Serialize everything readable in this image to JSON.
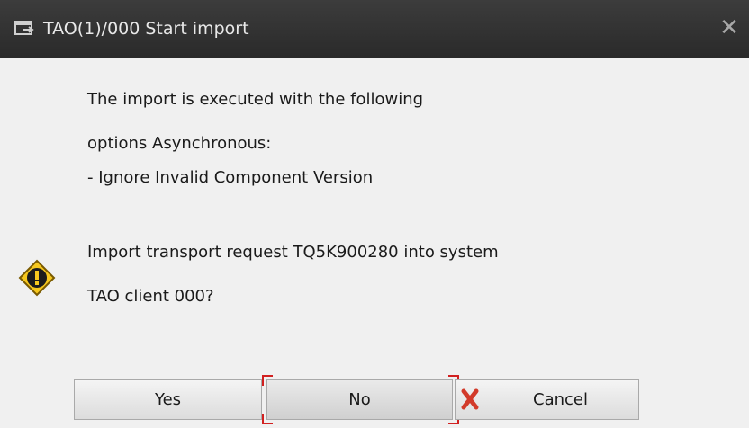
{
  "dialog": {
    "title": "TAO(1)/000 Start import",
    "close_glyph": "✕",
    "title_icon": "window-icon"
  },
  "message": {
    "lines": [
      "The import is executed with the following",
      "options Asynchronous:",
      "- Ignore Invalid Component Version",
      "Import transport request TQ5K900280 into system",
      "TAO client 000?"
    ],
    "icon": "warning-icon"
  },
  "buttons": {
    "yes": "Yes",
    "no": "No",
    "cancel": "Cancel",
    "cancel_icon": "red-x-icon"
  },
  "colors": {
    "titlebar": "#333333",
    "focus": "#d12020",
    "warning_fill": "#f7c81e",
    "cancel_x": "#d23a2a"
  }
}
